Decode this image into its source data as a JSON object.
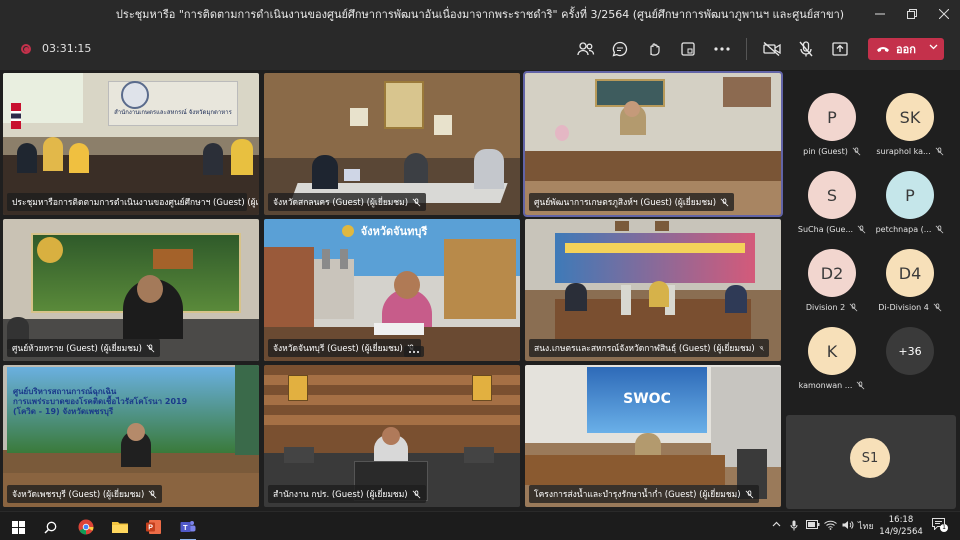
{
  "window": {
    "title": "ประชุมหารือ \"การติดตามการดำเนินงานของศูนย์ศึกษาการพัฒนาอันเนื่องมาจากพระราชดำริ\" ครั้งที่ 3/2564 (ศูนย์ศึกษาการพัฒนาภูพานฯ และศูนย์สาขา)"
  },
  "toolbar": {
    "timer": "03:31:15",
    "leave_label": "ออก"
  },
  "tiles": [
    {
      "name": "ประชุมหารือการติดตามการดำเนินงานของศูนย์ศึกษาฯ (Guest) (ผู้เยี่ยมชม)"
    },
    {
      "name": "จังหวัดสกลนคร (Guest) (ผู้เยี่ยมชม)"
    },
    {
      "name": "ศูนย์พัฒนาการเกษตรภูสิงห์ฯ (Guest) (ผู้เยี่ยมชม)"
    },
    {
      "name": "ศูนย์ห้วยทราย (Guest) (ผู้เยี่ยมชม)"
    },
    {
      "name": "จังหวัดจันทบุรี (Guest) (ผู้เยี่ยมชม)"
    },
    {
      "name": "สนง.เกษตรและสหกรณ์จังหวัดกาฬสินธุ์ (Guest) (ผู้เยี่ยมชม)"
    },
    {
      "name": "จังหวัดเพชรบุรี (Guest) (ผู้เยี่ยมชม)"
    },
    {
      "name": "สำนักงาน กปร. (Guest) (ผู้เยี่ยมชม)"
    },
    {
      "name": "โครงการส่งน้ำและบำรุงรักษาน้ำก่ำ (Guest) (ผู้เยี่ยมชม)"
    }
  ],
  "tile_texts": {
    "sign_top_left": "สำนักงานเกษตรและสหกรณ์ จังหวัดมุกดาหาร",
    "banner_center": "จังหวัดจันทบุรี",
    "poster_line1": "ศูนย์บริหารสถานการณ์ฉุกเฉิน",
    "poster_line2": "การแพร่ระบาดของโรคติดเชื้อไวรัสโคโรนา 2019",
    "poster_line3": "(โควิด - 19) จังหวัดเพชรบุรี",
    "swoc": "SWOC"
  },
  "participants": [
    {
      "initials": "P",
      "label": "pin (Guest)",
      "color": "#f2d6cf"
    },
    {
      "initials": "SK",
      "label": "suraphol ka...",
      "color": "#f7e0b9"
    },
    {
      "initials": "S",
      "label": "SuCha (Gue...",
      "color": "#f2d6cf"
    },
    {
      "initials": "P",
      "label": "petchnapa (...",
      "color": "#c5e6ea"
    },
    {
      "initials": "D2",
      "label": "Division 2",
      "color": "#f2d6cf"
    },
    {
      "initials": "D4",
      "label": "Di-Division 4",
      "color": "#f7e0b9"
    },
    {
      "initials": "K",
      "label": "kamonwan ...",
      "color": "#f7e0b9"
    }
  ],
  "overflow": {
    "label": "+36"
  },
  "self": {
    "initials": "S1",
    "color": "#f7e0b9"
  },
  "taskbar": {
    "lang": "ไทย",
    "time": "16:18",
    "date": "14/9/2564",
    "notif_count": "1"
  }
}
